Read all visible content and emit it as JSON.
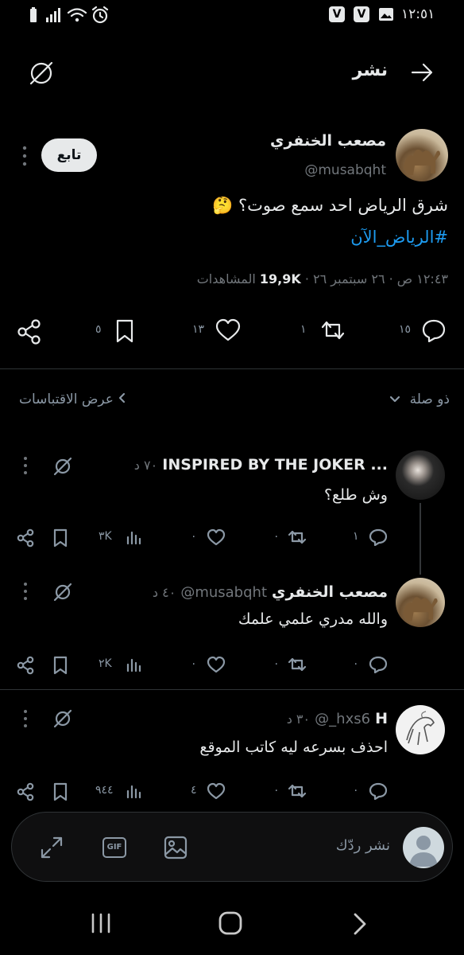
{
  "status_bar": {
    "time": "١٢:٥١"
  },
  "header": {
    "title": "نشر"
  },
  "post": {
    "author_name": "مصعب الخنفري",
    "author_handle": "@musabqht",
    "follow_label": "تابع",
    "text": "شرق الرياض احد سمع صوت؟",
    "emoji": "🤔",
    "hashtag": "#الرياض_الآن",
    "time": "١٢:٤٣ ص",
    "date": "٢٦ سبتمبر ٢٦",
    "views_count": "19,9K",
    "views_label": "المشاهدات",
    "replies": "١٥",
    "reposts": "١",
    "likes": "١٣",
    "bookmarks": "٥"
  },
  "sort_bar": {
    "relevance_label": "ذو صلة",
    "quotes_label": "عرض الاقتباسات"
  },
  "replies": [
    {
      "name": "INSPIRED BY THE JOKER ...",
      "handle": "",
      "time": "٧٠ د",
      "text": "وش طلع؟",
      "replies": "١",
      "reposts": "٠",
      "likes": "٠",
      "views": "٣K"
    },
    {
      "name": "مصعب الخنفري",
      "handle": "@musabqht",
      "time": "٤٠ د",
      "text": "والله مدري علمي علمك",
      "replies": "٠",
      "reposts": "٠",
      "likes": "٠",
      "views": "٢K"
    },
    {
      "name": "H",
      "handle": "@_hxs6",
      "time": "٣٠ د",
      "text": "احذف بسرعه ليه كاتب الموقع",
      "replies": "٠",
      "reposts": "٠",
      "likes": "٤",
      "views": "٩٤٤"
    }
  ],
  "composer": {
    "placeholder": "نشر ردّك",
    "gif_label": "GIF"
  }
}
